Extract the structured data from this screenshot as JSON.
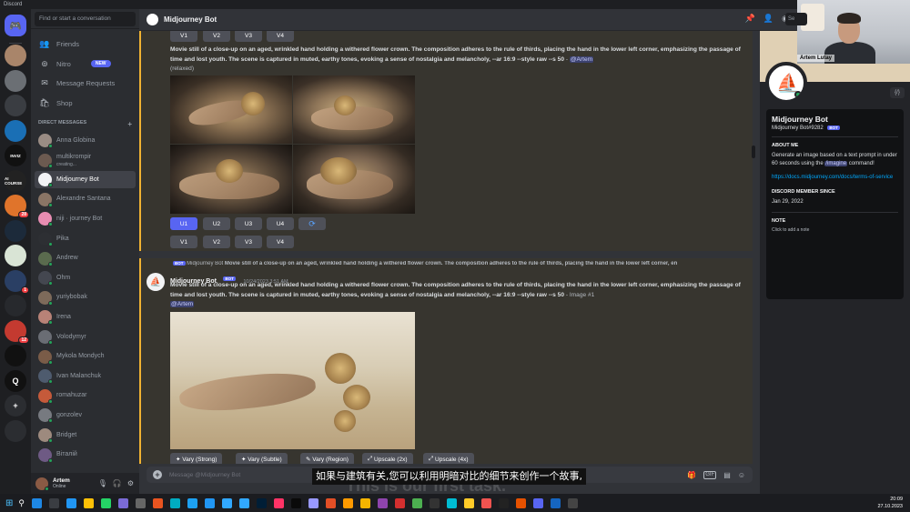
{
  "window": {
    "title": "Discord"
  },
  "servers": [
    {
      "name": "home-icon",
      "color": "#5865f2",
      "label": ""
    },
    {
      "name": "server-avatar-1",
      "color": "#a9856a",
      "label": ""
    },
    {
      "name": "server-avatar-2",
      "color": "#6b6f74",
      "label": ""
    },
    {
      "name": "server-avatar-3",
      "color": "#3a3d42",
      "label": ""
    },
    {
      "name": "server-avatar-4",
      "color": "#1a6fb5",
      "label": ""
    },
    {
      "name": "server-inviz",
      "color": "#111111",
      "label": "INVIZ"
    },
    {
      "name": "server-ai-course",
      "color": "#222222",
      "label": "AI COURSE"
    },
    {
      "name": "server-fox",
      "color": "#e0742b",
      "label": "",
      "badge": "28"
    },
    {
      "name": "server-plane",
      "color": "#1c2a3a",
      "label": ""
    },
    {
      "name": "server-greens",
      "color": "#d9e4d5",
      "label": ""
    },
    {
      "name": "server-vk",
      "color": "#2a3f64",
      "label": "",
      "badge": "1"
    },
    {
      "name": "server-dark",
      "color": "#27292d",
      "label": ""
    },
    {
      "name": "server-gmail",
      "color": "#c43a30",
      "label": "",
      "badge": "12"
    },
    {
      "name": "server-square",
      "color": "#111111",
      "label": ""
    },
    {
      "name": "server-q",
      "color": "#111111",
      "label": "Q"
    },
    {
      "name": "add-server",
      "color": "#2b2d31",
      "label": "+"
    },
    {
      "name": "explore-servers",
      "color": "#2b2d31",
      "label": ""
    }
  ],
  "dm_panel": {
    "search_placeholder": "Find or start a conversation",
    "nav": [
      {
        "label": "Friends",
        "icon": "friends-icon"
      },
      {
        "label": "Nitro",
        "icon": "nitro-icon",
        "badge": "NEW"
      },
      {
        "label": "Message Requests",
        "icon": "mail-icon"
      },
      {
        "label": "Shop",
        "icon": "shop-icon"
      }
    ],
    "header": "DIRECT MESSAGES",
    "add_label": "+",
    "items": [
      {
        "name": "Anna Globina",
        "color": "#9a8c84"
      },
      {
        "name": "multikrompir",
        "sub": "creating...",
        "color": "#6c5a50"
      },
      {
        "name": "Midjourney Bot",
        "color": "#f2f3f5",
        "active": true
      },
      {
        "name": "Alexandre Santana",
        "color": "#8a7565"
      },
      {
        "name": "niji · journey Bot",
        "color": "#e88db2"
      },
      {
        "name": "Pika",
        "color": "#2d2f33"
      },
      {
        "name": "Andrew",
        "color": "#5a6b4e"
      },
      {
        "name": "Ohm",
        "color": "#444750"
      },
      {
        "name": "yuriybobak",
        "color": "#7d6a5a"
      },
      {
        "name": "Irena",
        "color": "#b88277"
      },
      {
        "name": "Volodymyr",
        "color": "#6a6d74"
      },
      {
        "name": "Mykola Mondych",
        "color": "#7a5c48"
      },
      {
        "name": "Ivan Malanchuk",
        "color": "#4e5b6e"
      },
      {
        "name": "romahuzar",
        "color": "#c55a3a"
      },
      {
        "name": "gonzolev",
        "color": "#777a80"
      },
      {
        "name": "Bridget",
        "color": "#9d8a7e"
      },
      {
        "name": "Віталій",
        "color": "#6e5a84"
      }
    ]
  },
  "user_panel": {
    "name": "Artem",
    "status": "Online"
  },
  "channel": {
    "title": "Midjourney Bot",
    "search_label": "Se"
  },
  "message1": {
    "variation_row_top": [
      "V1",
      "V2",
      "V3",
      "V4"
    ],
    "prompt": "Movie still of a close-up on an aged, wrinkled hand holding a withered flower crown. The composition adheres to the rule of thirds, placing the hand in the lower left corner, emphasizing the passage of time and lost youth. The scene is captured in muted, earthy tones, evoking a sense of nostalgia and melancholy, --ar 16:9 --style raw --s 50",
    "mention": "@Artem",
    "mode": "(relaxed)",
    "upscale_buttons": [
      "U1",
      "U2",
      "U3",
      "U4"
    ],
    "reroll_icon": "refresh-icon",
    "variation_buttons": [
      "V1",
      "V2",
      "V3",
      "V4"
    ]
  },
  "message2": {
    "reply_author": "Midjourney Bot",
    "reply_bot_tag": "BOT",
    "reply_text": "Movie still of a close-up on an aged, wrinkled hand holding a withered flower crown. The composition adheres to the rule of thirds, placing the hand in the lower left corner, en",
    "author": "Midjourney Bot",
    "bot_tag": "BOT",
    "timestamp": "10/24/2023 3:51 AM",
    "prompt": "Movie still of a close-up on an aged, wrinkled hand holding a withered flower crown. The composition adheres to the rule of thirds, placing the hand in the lower left corner, emphasizing the passage of time and lost youth. The scene is captured in muted, earthy tones, evoking a sense of nostalgia and melancholy, --ar 16:9 --style raw --s 50",
    "suffix": " - Image #1",
    "mention": "@Artem",
    "actions": [
      "Vary (Strong)",
      "Vary (Subtle)",
      "Vary (Region)",
      "Upscale (2x)",
      "Upscale (4x)"
    ]
  },
  "composer": {
    "placeholder": "Message @Midjourney Bot"
  },
  "subtitle": "如果与建筑有关,您可以利用明暗对比的细节来创作一个故事,",
  "ghost_subtitle": "This is our first task.",
  "profile": {
    "name": "Midjourney Bot",
    "tag": "Midjourney Bot#9282",
    "bot_tag": "BOT",
    "about_header": "ABOUT ME",
    "about_text": "Generate an image based on a text prompt in under 60 seconds using the",
    "about_command": "/imagine",
    "about_tail": "command!",
    "link": "https://docs.midjourney.com/docs/terms-of-service",
    "member_header": "DISCORD MEMBER SINCE",
    "member_date": "Jan 29, 2022",
    "note_header": "NOTE",
    "note_placeholder": "Click to add a note",
    "badge": "{/}"
  },
  "webcam": {
    "label": "Artem Lutay"
  },
  "taskbar": {
    "time": "20:09",
    "date": "27.10.2023",
    "apps": [
      "#1e88e5",
      "#3a3d42",
      "#2196f3",
      "#ffc107",
      "#25d366",
      "#7b6bd6",
      "#666",
      "#e95420",
      "#00acc1",
      "#1da1f2",
      "#2196f3",
      "#31a8ff",
      "#31a8ff",
      "#001e36",
      "#ff3366",
      "#0a0a0a",
      "#9999ff",
      "#e34f26",
      "#ff9a00",
      "#f4b400",
      "#8e44ad",
      "#d32f2f",
      "#4caf50",
      "#333",
      "#00bcd4",
      "#ffca28",
      "#ef5350",
      "#222",
      "#e65100",
      "#5865f2",
      "#1565c0",
      "#444"
    ]
  }
}
